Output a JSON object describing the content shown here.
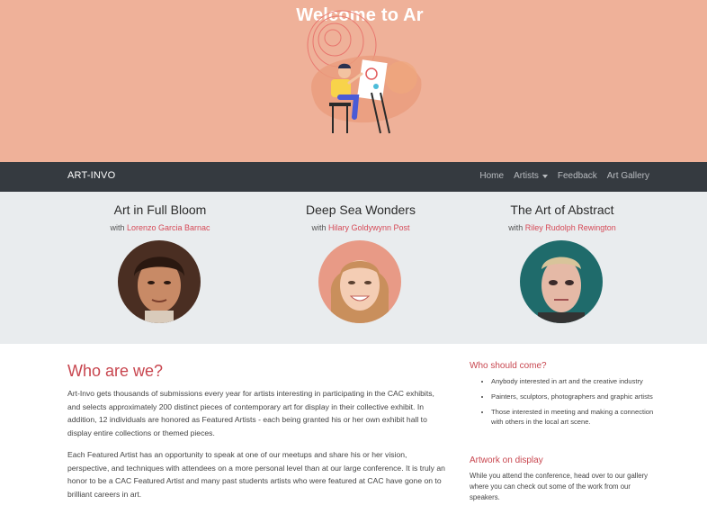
{
  "hero": {
    "title": "Welcome to Ar"
  },
  "navbar": {
    "brand": "ART-INVO",
    "links": [
      "Home",
      "Artists",
      "Feedback",
      "Art Gallery"
    ]
  },
  "featured": [
    {
      "title": "Art in Full Bloom",
      "with": "with",
      "artist": "Lorenzo Garcia Barnac"
    },
    {
      "title": "Deep Sea Wonders",
      "with": "with",
      "artist": "Hilary Goldywynn Post"
    },
    {
      "title": "The Art of Abstract",
      "with": "with",
      "artist": "Riley Rudolph Rewington"
    }
  ],
  "about": {
    "heading": "Who are we?",
    "p1": "Art-Invo gets thousands of submissions every year for artists interesting in participating in the CAC exhibits, and selects approximately 200 distinct pieces of contemporary art for display in their collective exhibit. In addition, 12 individuals are honored as Featured Artists - each being granted his or her own exhibit hall to display entire collections or themed pieces.",
    "p2": "Each Featured Artist has an opportunity to speak at one of our meetups and share his or her vision, perspective, and techniques with attendees on a more personal level than at our large conference. It is truly an honor to be a CAC Featured Artist and many past students artists who were featured at CAC have gone on to brilliant careers in art."
  },
  "sidebar": {
    "who_heading": "Who should come?",
    "who_items": [
      "Anybody interested in art and the creative industry",
      "Painters, sculptors, photographers and graphic artists",
      "Those interested in meeting and making a connection with others in the local art scene."
    ],
    "artwork_heading": "Artwork on display",
    "artwork_text": "While you attend the conference, head over to our gallery where you can check out some of the work from our speakers."
  },
  "colors": {
    "hero_bg": "#efb199",
    "navbar_bg": "#353a40",
    "accent": "#c8464f",
    "featured_bg": "#e9ecee"
  }
}
